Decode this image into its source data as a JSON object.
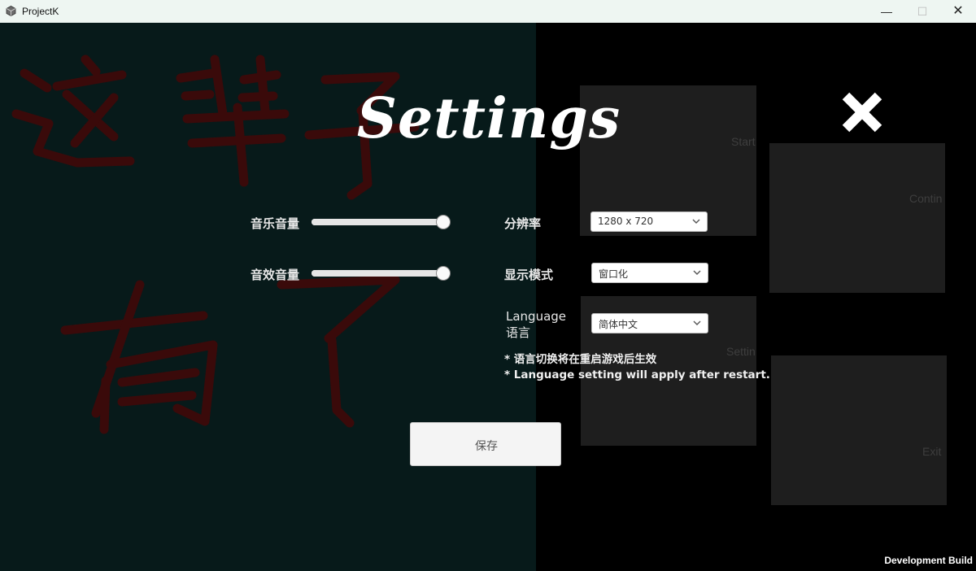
{
  "window": {
    "title": "ProjectK",
    "minimize_symbol": "—",
    "maximize_symbol": "☐",
    "close_symbol": "✕"
  },
  "main_menu": {
    "start_label": "Start",
    "continue_label": "Contin",
    "settings_label": "Settin",
    "exit_label": "Exit"
  },
  "settings": {
    "title": "Settings",
    "music_volume_label": "音乐音量",
    "music_volume_value": 0.95,
    "sfx_volume_label": "音效音量",
    "sfx_volume_value": 0.95,
    "resolution_label": "分辨率",
    "resolution_value": "1280 x 720",
    "display_mode_label": "显示模式",
    "display_mode_value": "窗口化",
    "language_label_en": "Language",
    "language_label_zh": "语言",
    "language_value": "简体中文",
    "note_zh": "* 语言切换将在重启游戏后生效",
    "note_en": "* Language setting will apply after restart.",
    "save_label": "保存"
  },
  "footer": {
    "dev_build": "Development Build"
  },
  "colors": {
    "left_background": "#071a1a",
    "right_background": "#000000",
    "scribble": "#3a0a0a",
    "menu_panel": "#1e1e1e"
  },
  "icons": [
    "app-cube-icon",
    "close-x-icon",
    "chevron-down-icon"
  ]
}
